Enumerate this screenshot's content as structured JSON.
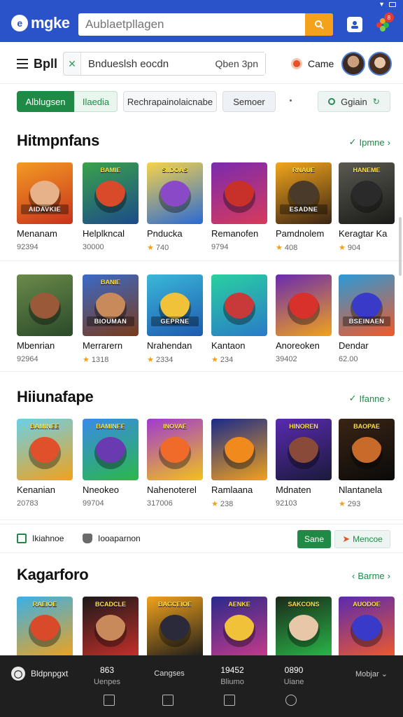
{
  "status": {
    "wifi": "wifi-icon",
    "battery": "battery-icon"
  },
  "topbar": {
    "logo_text": "mgke",
    "search_placeholder": "Aublaetpllagen",
    "search_icon": "search-icon",
    "badge": "8"
  },
  "toolbar": {
    "title": "Bpll",
    "search_value": "Bndueslsh eocdn",
    "search_button": "Qben 3pn",
    "game_label": "Came"
  },
  "chips": [
    "Alblugsen",
    "Ilaedia",
    "Rechrapainolaicnabe",
    "Semoer",
    "Ggiain"
  ],
  "sections": [
    {
      "title": "Hitmpnfans",
      "more": "Ipmne",
      "rows": [
        [
          {
            "name": "Menanam",
            "meta": "92394",
            "star": false,
            "banner": "AIDAVKIE",
            "toptag": "",
            "bg": [
              "#f39a24",
              "#c8331c"
            ],
            "art": "#e7b28a"
          },
          {
            "name": "Helplkncal",
            "meta": "30000",
            "star": false,
            "banner": "",
            "toptag": "BAMIE",
            "bg": [
              "#3aa24a",
              "#1c4a8a"
            ],
            "art": "#d84a2a"
          },
          {
            "name": "Pnducka",
            "meta": "740",
            "star": true,
            "banner": "",
            "toptag": "SIIDOAS",
            "bg": [
              "#f6d34a",
              "#2a6ad4"
            ],
            "art": "#8a4ac8"
          },
          {
            "name": "Remanofen",
            "meta": "9794",
            "star": false,
            "banner": "",
            "toptag": "",
            "bg": [
              "#7a2ab0",
              "#d83a5a"
            ],
            "art": "#c8302a"
          },
          {
            "name": "Pamdnolem",
            "meta": "408",
            "star": true,
            "banner": "ESADNE",
            "toptag": "RNAUE",
            "bg": [
              "#f2a61c",
              "#3a2414"
            ],
            "art": "#4a3a2a"
          },
          {
            "name": "Keragtar Ka",
            "meta": "904",
            "star": true,
            "banner": "",
            "toptag": "HANEME",
            "bg": [
              "#5a5a52",
              "#1a1a18"
            ],
            "art": "#2a2a2a"
          }
        ],
        [
          {
            "name": "Mbenrian",
            "meta": "92964",
            "star": false,
            "banner": "",
            "toptag": "",
            "bg": [
              "#6a8a4a",
              "#2a4a2a"
            ],
            "art": "#9a5a3a"
          },
          {
            "name": "Merrarern",
            "meta": "1318",
            "star": true,
            "banner": "BIOUMAN",
            "toptag": "BANIE",
            "bg": [
              "#3a6ac8",
              "#7a3a1a"
            ],
            "art": "#c88a5a"
          },
          {
            "name": "Nrahendan",
            "meta": "2334",
            "star": true,
            "banner": "GEPRNE",
            "toptag": "",
            "bg": [
              "#3ab8d8",
              "#1e5ab0"
            ],
            "art": "#f0c23a"
          },
          {
            "name": "Kantaon",
            "meta": "234",
            "star": true,
            "banner": "",
            "toptag": "",
            "bg": [
              "#2ad0a0",
              "#2a7ac8"
            ],
            "art": "#c83a3a"
          },
          {
            "name": "Anoreoken",
            "meta": "39402",
            "star": false,
            "banner": "",
            "toptag": "",
            "bg": [
              "#6a2ab0",
              "#f0a21c"
            ],
            "art": "#d8302a"
          },
          {
            "name": "Dendar",
            "meta": "62.00",
            "star": false,
            "banner": "BSEINAEN",
            "toptag": "",
            "bg": [
              "#2a9ad8",
              "#f05a2a"
            ],
            "art": "#3a3ac8"
          }
        ]
      ]
    },
    {
      "title": "Hiiunafape",
      "more": "Ifanne",
      "rows": [
        [
          {
            "name": "Kenanian",
            "meta": "20783",
            "star": false,
            "banner": "",
            "toptag": "BAMINEE",
            "bg": [
              "#6ad0e8",
              "#f0a21c"
            ],
            "art": "#e0502a"
          },
          {
            "name": "Nneokeo",
            "meta": "99704",
            "star": false,
            "banner": "",
            "toptag": "BAMINEE",
            "bg": [
              "#3a8ae8",
              "#2ab84a"
            ],
            "art": "#6a3ab0"
          },
          {
            "name": "Nahenoterel",
            "meta": "317006",
            "star": false,
            "banner": "",
            "toptag": "INOVAE",
            "bg": [
              "#a03ad0",
              "#f0c21c"
            ],
            "art": "#f06a2a"
          },
          {
            "name": "Ramlaana",
            "meta": "238",
            "star": true,
            "banner": "",
            "toptag": "",
            "bg": [
              "#1a2a8a",
              "#f0a21c"
            ],
            "art": "#f08a1c"
          },
          {
            "name": "Mdnaten",
            "meta": "92103",
            "star": false,
            "banner": "",
            "toptag": "HINOREN",
            "bg": [
              "#5a2ab0",
              "#1a1a3a"
            ],
            "art": "#8a4a3a"
          },
          {
            "name": "Nlantanela",
            "meta": "293",
            "star": true,
            "banner": "",
            "toptag": "BAOPAE",
            "bg": [
              "#3a2414",
              "#0a0a0a"
            ],
            "art": "#c86a2a"
          }
        ]
      ]
    },
    {
      "title": "Kagarforo",
      "more": "Barme",
      "rows": [
        [
          {
            "name": "",
            "meta": "",
            "star": false,
            "banner": "",
            "toptag": "RAEIOE",
            "bg": [
              "#3ab0e8",
              "#f0a21c"
            ],
            "art": "#d84a2a"
          },
          {
            "name": "",
            "meta": "",
            "star": false,
            "banner": "",
            "toptag": "BCADCLE",
            "bg": [
              "#1a1a1a",
              "#c8302a"
            ],
            "art": "#c88a5a"
          },
          {
            "name": "",
            "meta": "",
            "star": false,
            "banner": "",
            "toptag": "BAGCEIOE",
            "bg": [
              "#f0a21c",
              "#1a1a1a"
            ],
            "art": "#2a2a3a"
          },
          {
            "name": "",
            "meta": "",
            "star": false,
            "banner": "",
            "toptag": "AENKE",
            "bg": [
              "#2a2a8a",
              "#c83a8a"
            ],
            "art": "#f0c23a"
          },
          {
            "name": "",
            "meta": "",
            "star": false,
            "banner": "",
            "toptag": "SAKCONS",
            "bg": [
              "#1a2a1a",
              "#2ab84a"
            ],
            "art": "#e8c6a8"
          },
          {
            "name": "",
            "meta": "",
            "star": false,
            "banner": "",
            "toptag": "AUODOE",
            "bg": [
              "#5a2ab0",
              "#f05a2a"
            ],
            "art": "#3a3ac8"
          }
        ]
      ]
    }
  ],
  "info_row": {
    "a": "Ikiahnoe",
    "b": "Iooaparnon",
    "save": "Sane",
    "more": "Mencoe"
  },
  "bottombar": {
    "profile": "Bldpnpgxt",
    "stats": [
      {
        "value": "863",
        "label": "Uenpes"
      },
      {
        "value": "",
        "label": "Cangses"
      },
      {
        "value": "19452",
        "label": "Bliumo"
      },
      {
        "value": "0890",
        "label": "Uiane"
      }
    ],
    "mobile": "Mobjar"
  }
}
